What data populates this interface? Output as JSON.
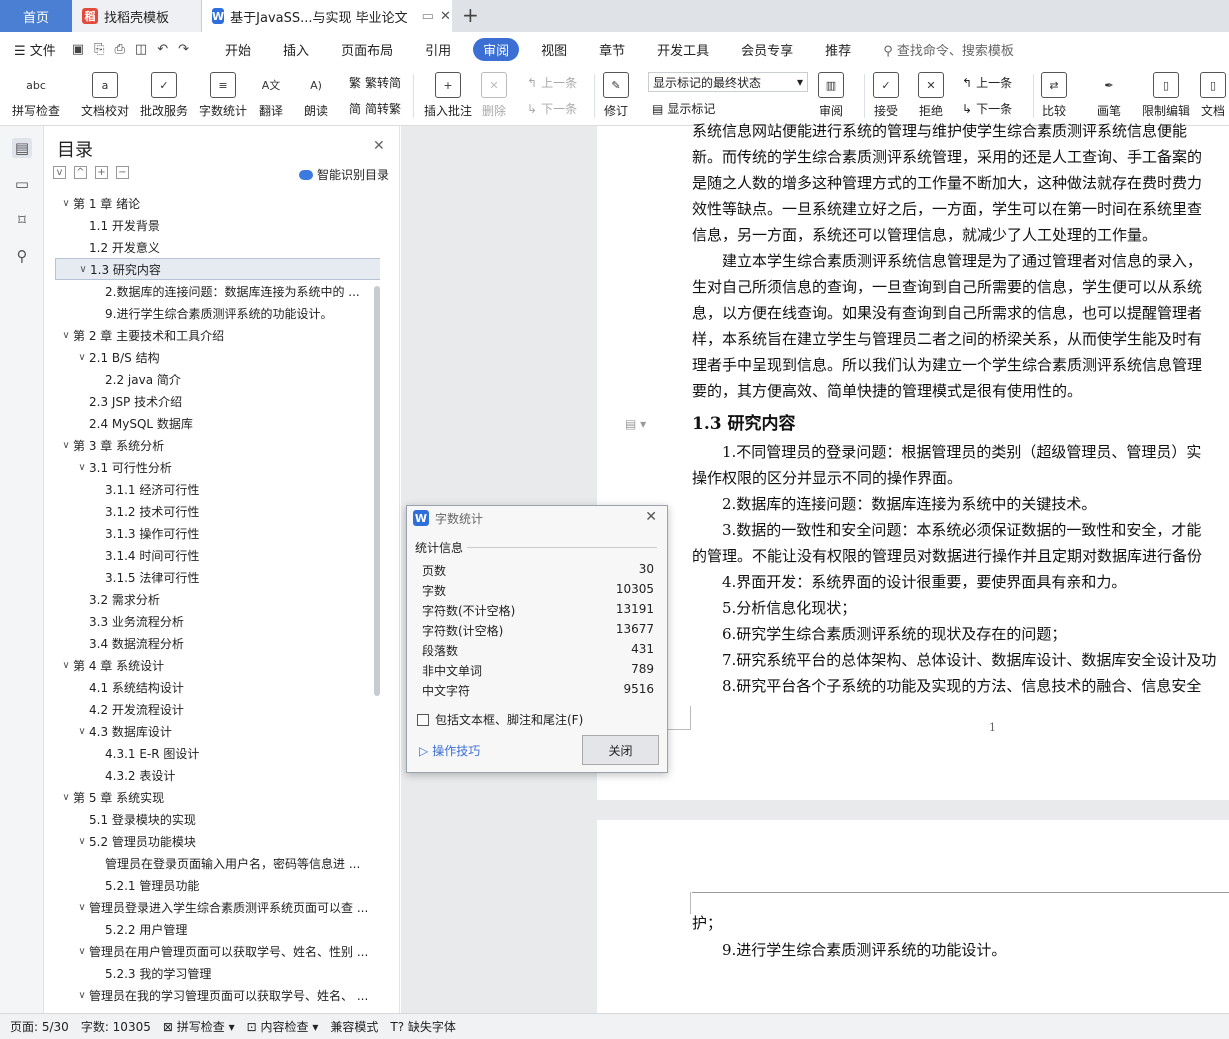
{
  "tabs": {
    "home": "首页",
    "tab2": "找稻壳模板",
    "tab3": "基于JavaSS...与实现 毕业论文",
    "new_tab": "+"
  },
  "menu": {
    "file": "文件",
    "items": [
      "开始",
      "插入",
      "页面布局",
      "引用",
      "审阅",
      "视图",
      "章节",
      "开发工具",
      "会员专享",
      "推荐"
    ],
    "active": "审阅",
    "search": "查找命令、搜索模板"
  },
  "ribbon": {
    "spellcheck": "拼写检查",
    "doc_proof": "文档校对",
    "batch_proof": "批改服务",
    "word_count": "字数统计",
    "translate": "翻译",
    "read": "朗读",
    "trad": "繁转简",
    "simp": "简转繁",
    "insert_comment": "插入批注",
    "delete": "删除",
    "prev_comment": "上一条",
    "next_comment": "下一条",
    "track": "修订",
    "markup_select": "显示标记的最终状态",
    "show_markup": "显示标记",
    "review": "审阅",
    "accept": "接受",
    "reject": "拒绝",
    "prev": "上一条",
    "next": "下一条",
    "compare": "比较",
    "pen": "画笔",
    "restrict": "限制编辑",
    "doc_permission": "文档"
  },
  "toc": {
    "title": "目录",
    "smart": "智能识别目录",
    "items": [
      {
        "text": "第 1 章  绪论",
        "level": 0,
        "arrow": "v"
      },
      {
        "text": "1.1 开发背景",
        "level": 1,
        "arrow": ""
      },
      {
        "text": "1.2 开发意义",
        "level": 1,
        "arrow": ""
      },
      {
        "text": "1.3 研究内容",
        "level": 1,
        "arrow": "v",
        "selected": true
      },
      {
        "text": "2.数据库的连接问题：数据库连接为系统中的 ...",
        "level": 2,
        "arrow": ""
      },
      {
        "text": "9.进行学生综合素质测评系统的功能设计。",
        "level": 2,
        "arrow": ""
      },
      {
        "text": "第 2 章  主要技术和工具介绍",
        "level": 0,
        "arrow": "v"
      },
      {
        "text": "2.1 B/S 结构",
        "level": 1,
        "arrow": "v"
      },
      {
        "text": "2.2 java 简介",
        "level": 2,
        "arrow": ""
      },
      {
        "text": "2.3 JSP 技术介绍",
        "level": 1,
        "arrow": ""
      },
      {
        "text": "2.4 MySQL 数据库",
        "level": 1,
        "arrow": ""
      },
      {
        "text": " 第 3 章  系统分析",
        "level": 0,
        "arrow": "v"
      },
      {
        "text": "3.1 可行性分析",
        "level": 1,
        "arrow": "v"
      },
      {
        "text": "3.1.1 经济可行性",
        "level": 2,
        "arrow": ""
      },
      {
        "text": "3.1.2 技术可行性",
        "level": 2,
        "arrow": ""
      },
      {
        "text": "3.1.3 操作可行性",
        "level": 2,
        "arrow": ""
      },
      {
        "text": "3.1.4  时间可行性",
        "level": 2,
        "arrow": ""
      },
      {
        "text": "3.1.5  法律可行性",
        "level": 2,
        "arrow": ""
      },
      {
        "text": "3.2 需求分析",
        "level": 1,
        "arrow": ""
      },
      {
        "text": "3.3 业务流程分析",
        "level": 1,
        "arrow": ""
      },
      {
        "text": "3.4 数据流程分析",
        "level": 1,
        "arrow": ""
      },
      {
        "text": "第 4 章  系统设计",
        "level": 0,
        "arrow": "v"
      },
      {
        "text": "4.1 系统结构设计",
        "level": 1,
        "arrow": ""
      },
      {
        "text": "4.2 开发流程设计",
        "level": 1,
        "arrow": ""
      },
      {
        "text": "4.3 数据库设计",
        "level": 1,
        "arrow": "v"
      },
      {
        "text": "4.3.1 E-R 图设计",
        "level": 2,
        "arrow": ""
      },
      {
        "text": "4.3.2 表设计",
        "level": 2,
        "arrow": ""
      },
      {
        "text": "第 5 章    系统实现",
        "level": 0,
        "arrow": "v"
      },
      {
        "text": "5.1 登录模块的实现",
        "level": 1,
        "arrow": ""
      },
      {
        "text": "5.2 管理员功能模块",
        "level": 1,
        "arrow": "v"
      },
      {
        "text": "管理员在登录页面输入用户名，密码等信息进 ...",
        "level": 2,
        "arrow": ""
      },
      {
        "text": "5.2.1 管理员功能",
        "level": 2,
        "arrow": ""
      },
      {
        "text": "管理员登录进入学生综合素质测评系统页面可以查 ...",
        "level": 1,
        "arrow": "v"
      },
      {
        "text": "5.2.2 用户管理",
        "level": 2,
        "arrow": ""
      },
      {
        "text": "管理员在用户管理页面可以获取学号、姓名、性别 ...",
        "level": 1,
        "arrow": "v"
      },
      {
        "text": "5.2.3 我的学习管理",
        "level": 2,
        "arrow": ""
      },
      {
        "text": "管理员在我的学习管理页面可以获取学号、姓名、 ...",
        "level": 1,
        "arrow": "v"
      }
    ]
  },
  "doc": {
    "lines": [
      "系统信息网站便能进行系统的管理与维护使学生综合素质测评系统信息便能",
      "新。而传统的学生综合素质测评系统管理，采用的还是人工查询、手工备案的",
      "是随之人数的增多这种管理方式的工作量不断加大，这种做法就存在费时费力",
      "效性等缺点。一旦系统建立好之后，一方面，学生可以在第一时间在系统里查",
      "信息，另一方面，系统还可以管理信息，就减少了人工处理的工作量。",
      "　　建立本学生综合素质测评系统信息管理是为了通过管理者对信息的录入，",
      "生对自己所须信息的查询，一旦查询到自己所需要的信息，学生便可以从系统",
      "息，以方便在线查询。如果没有查询到自己所需求的信息，也可以提醒管理者",
      "样，本系统旨在建立学生与管理员二者之间的桥梁关系，从而使学生能及时有",
      "理者手中呈现到信息。所以我们认为建立一个学生综合素质测评系统信息管理",
      "要的，其方便高效、简单快捷的管理模式是很有使用性的。"
    ],
    "heading": "1.3 研究内容",
    "lines2": [
      "　　1.不同管理员的登录问题：根据管理员的类别（超级管理员、管理员）实",
      "操作权限的区分并显示不同的操作界面。",
      "　　2.数据库的连接问题：数据库连接为系统中的关键技术。",
      "　　3.数据的一致性和安全问题：本系统必须保证数据的一致性和安全，才能",
      "的管理。不能让没有权限的管理员对数据进行操作并且定期对数据库进行备份",
      "　　4.界面开发：系统界面的设计很重要，要使界面具有亲和力。",
      "　　5.分析信息化现状；",
      "　　6.研究学生综合素质测评系统的现状及存在的问题；",
      "　　7.研究系统平台的总体架构、总体设计、数据库设计、数据库安全设计及功",
      "　　8.研究平台各个子系统的功能及实现的方法、信息技术的融合、信息安全"
    ],
    "page_num": "1",
    "page2_lines": [
      "护；",
      "　　9.进行学生综合素质测评系统的功能设计。"
    ]
  },
  "dialog": {
    "title": "字数统计",
    "section": "统计信息",
    "stats": [
      {
        "label": "页数",
        "value": "30"
      },
      {
        "label": "字数",
        "value": "10305"
      },
      {
        "label": "字符数(不计空格)",
        "value": "13191"
      },
      {
        "label": "字符数(计空格)",
        "value": "13677"
      },
      {
        "label": "段落数",
        "value": "431"
      },
      {
        "label": "非中文单词",
        "value": "789"
      },
      {
        "label": "中文字符",
        "value": "9516"
      }
    ],
    "checkbox": "包括文本框、脚注和尾注(F)",
    "tips": "操作技巧",
    "close": "关闭"
  },
  "status": {
    "page": "页面: 5/30",
    "words": "字数: 10305",
    "spell": "拼写检查",
    "content": "内容检查",
    "compat": "兼容模式",
    "font": "缺失字体"
  },
  "colors": {
    "accent": "#3b6fd4",
    "tab_home": "#4a7fd4",
    "wps_logo": "#2f6fdc",
    "docer_logo": "#e24a3b"
  }
}
